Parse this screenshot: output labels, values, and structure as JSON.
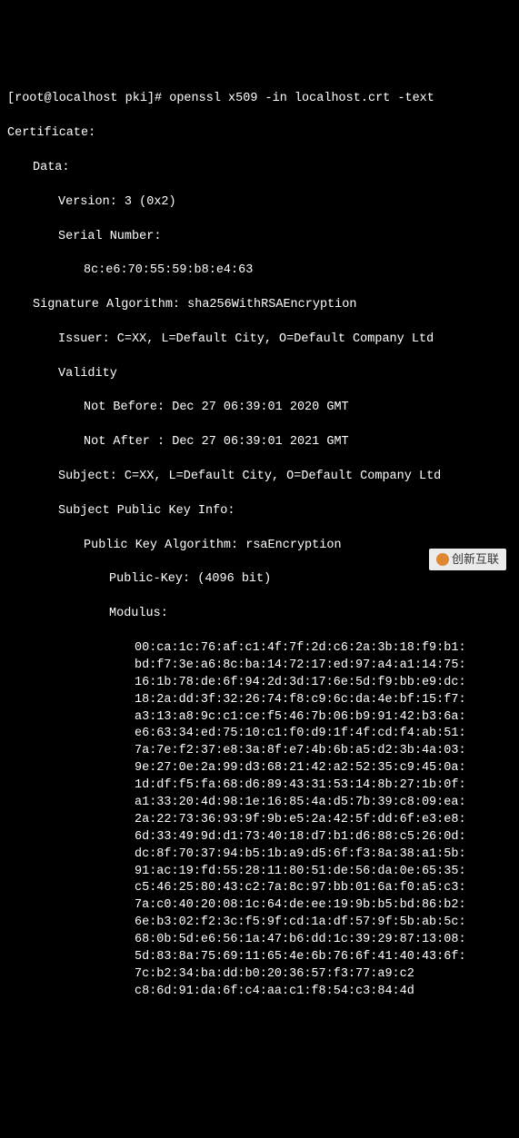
{
  "prompt": "[root@localhost pki]# openssl x509 -in localhost.crt -text",
  "cert": {
    "header": "Certificate:",
    "data_label": "Data:",
    "version": "Version: 3 (0x2)",
    "serial_label": "Serial Number:",
    "serial_value": "8c:e6:70:55:59:b8:e4:63",
    "sig_algo": "Signature Algorithm: sha256WithRSAEncryption",
    "issuer": "Issuer: C=XX, L=Default City, O=Default Company Ltd",
    "validity_label": "Validity",
    "not_before": "Not Before: Dec 27 06:39:01 2020 GMT",
    "not_after": "Not After : Dec 27 06:39:01 2021 GMT",
    "subject": "Subject: C=XX, L=Default City, O=Default Company Ltd",
    "spki_label": "Subject Public Key Info:",
    "pk_algo": "Public Key Algorithm: rsaEncryption",
    "pk_size": "Public-Key: (4096 bit)",
    "modulus_label": "Modulus:",
    "modulus_lines": [
      "00:ca:1c:76:af:c1:4f:7f:2d:c6:2a:3b:18:f9:b1:",
      "bd:f7:3e:a6:8c:ba:14:72:17:ed:97:a4:a1:14:75:",
      "16:1b:78:de:6f:94:2d:3d:17:6e:5d:f9:bb:e9:dc:",
      "18:2a:dd:3f:32:26:74:f8:c9:6c:da:4e:bf:15:f7:",
      "a3:13:a8:9c:c1:ce:f5:46:7b:06:b9:91:42:b3:6a:",
      "e6:63:34:ed:75:10:c1:f0:d9:1f:4f:cd:f4:ab:51:",
      "7a:7e:f2:37:e8:3a:8f:e7:4b:6b:a5:d2:3b:4a:03:",
      "9e:27:0e:2a:99:d3:68:21:42:a2:52:35:c9:45:0a:",
      "1d:df:f5:fa:68:d6:89:43:31:53:14:8b:27:1b:0f:",
      "a1:33:20:4d:98:1e:16:85:4a:d5:7b:39:c8:09:ea:",
      "2a:22:73:36:93:9f:9b:e5:2a:42:5f:dd:6f:e3:e8:",
      "6d:33:49:9d:d1:73:40:18:d7:b1:d6:88:c5:26:0d:",
      "dc:8f:70:37:94:b5:1b:a9:d5:6f:f3:8a:38:a1:5b:",
      "91:ac:19:fd:55:28:11:80:51:de:56:da:0e:65:35:",
      "c5:46:25:80:43:c2:7a:8c:97:bb:01:6a:f0:a5:c3:",
      "7a:c0:40:20:08:1c:64:de:ee:19:9b:b5:bd:86:b2:",
      "6e:b3:02:f2:3c:f5:9f:cd:1a:df:57:9f:5b:ab:5c:",
      "68:0b:5d:e6:56:1a:47:b6:dd:1c:39:29:87:13:08:",
      "5d:83:8a:75:69:11:65:4e:6b:76:6f:41:40:43:6f:",
      "7c:b2:34:ba:dd:b0:20:36:57:f3:77:a9:c2",
      "c8:6d:91:da:6f:c4:aa:c1:f8:54:c3:84:4d"
    ]
  },
  "watermark": {
    "text": "创新互联"
  }
}
